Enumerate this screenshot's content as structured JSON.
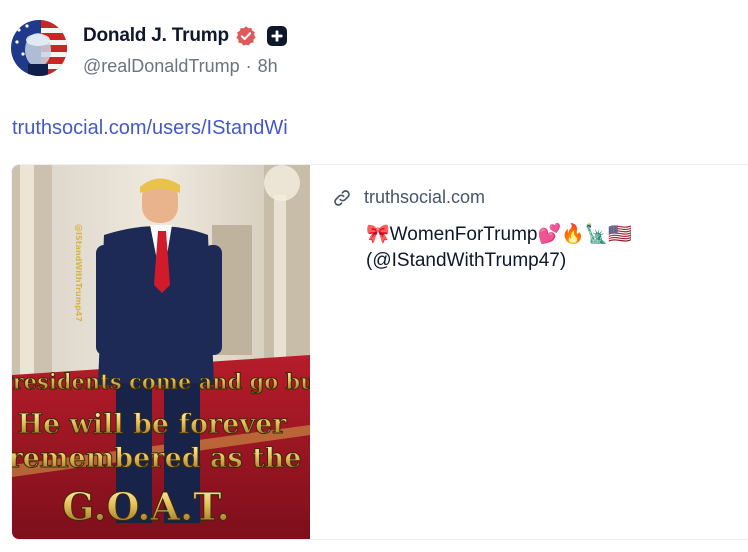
{
  "post": {
    "author_name": "Donald J. Trump",
    "handle": "@realDonaldTrump",
    "separator": "·",
    "time": "8h",
    "link_text": "truthsocial.com/users/IStandWi"
  },
  "card": {
    "domain": "truthsocial.com",
    "title_line1": "🎀WomenForTrump💕🔥🗽🇺🇸",
    "title_line2": "(@IStandWithTrump47)",
    "image": {
      "overlay_line1": "Presidents come and go but",
      "overlay_line2": "He will be forever",
      "overlay_line3": "remembered as the",
      "overlay_line4": "G.O.A.T.",
      "watermark": "@IStandWithTrump47"
    }
  },
  "icons": {
    "verified": "verified-badge-icon",
    "plus": "plus-badge-icon",
    "link": "link-icon"
  },
  "colors": {
    "accent_link": "#4459c7",
    "verified": "#e0585a",
    "text_muted": "#6b7280"
  }
}
